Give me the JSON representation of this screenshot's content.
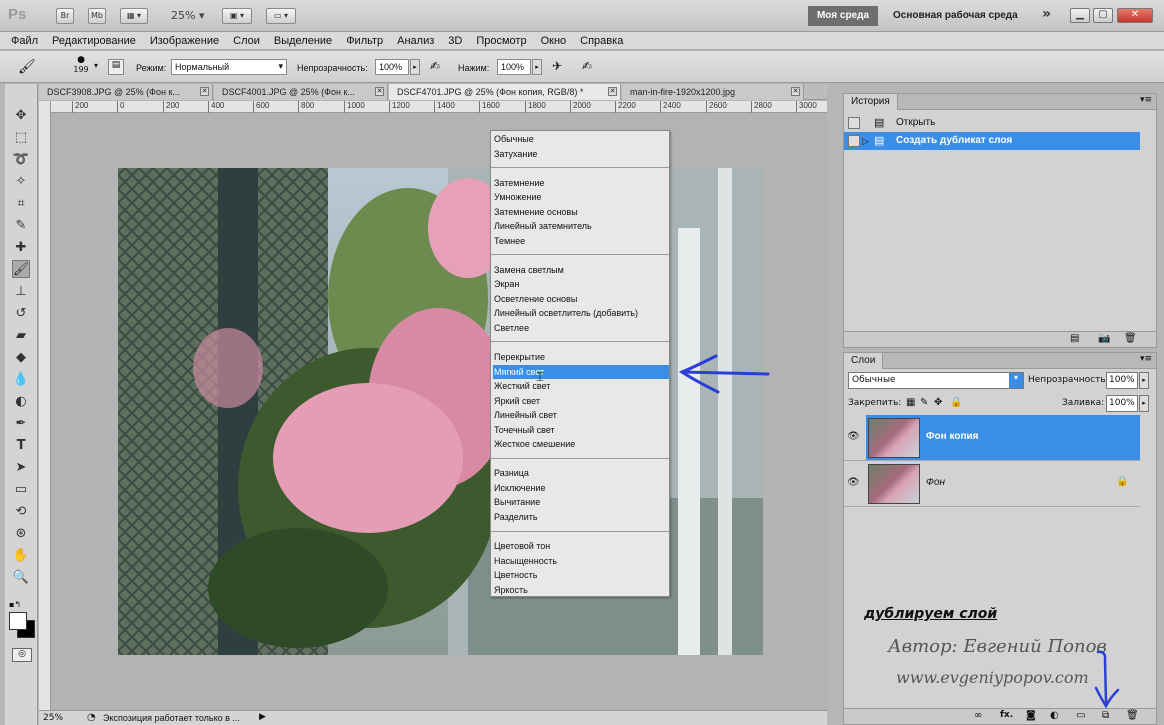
{
  "app": {
    "logo": "Ps",
    "bridge_btn": "Br",
    "mini_bridge_btn": "Mb",
    "zoom_level": "25%",
    "workspace_active": "Моя среда",
    "workspace_other": "Основная рабочая среда",
    "workspace_more": "»"
  },
  "menu": [
    "Файл",
    "Редактирование",
    "Изображение",
    "Слои",
    "Выделение",
    "Фильтр",
    "Анализ",
    "3D",
    "Просмотр",
    "Окно",
    "Справка"
  ],
  "options": {
    "brush_size": "199",
    "mode_label": "Режим:",
    "mode_value": "Нормальный",
    "opacity_label": "Непрозрачность:",
    "opacity_value": "100%",
    "flow_label": "Нажим:",
    "flow_value": "100%"
  },
  "doc_tabs": [
    "DSCF3908.JPG @ 25% (Фон к...",
    "DSCF4001.JPG @ 25% (Фон к...",
    "DSCF4701.JPG @ 25% (Фон копия, RGB/8) *",
    "man-in-fire-1920x1200.jpg"
  ],
  "ruler_ticks": [
    "200",
    "0",
    "200",
    "400",
    "600",
    "800",
    "1000",
    "1200",
    "1400",
    "1600",
    "1800",
    "2000",
    "2200",
    "2400",
    "2600",
    "2800",
    "3000"
  ],
  "blend_groups": [
    [
      "Обычные",
      "Затухание"
    ],
    [
      "Затемнение",
      "Умножение",
      "Затемнение основы",
      "Линейный затемнитель",
      "Темнее"
    ],
    [
      "Замена светлым",
      "Экран",
      "Осветление основы",
      "Линейный осветлитель (добавить)",
      "Светлее"
    ],
    [
      "Перекрытие",
      "Мягкий свет",
      "Жесткий свет",
      "Яркий свет",
      "Линейный свет",
      "Точечный свет",
      "Жесткое смешение"
    ],
    [
      "Разница",
      "Исключение",
      "Вычитание",
      "Разделить"
    ],
    [
      "Цветовой тон",
      "Насыщенность",
      "Цветность",
      "Яркость"
    ]
  ],
  "blend_selected": "Мягкий свет",
  "status": {
    "zoom": "25%",
    "info": "Экспозиция работает только в ..."
  },
  "history": {
    "tab": "История",
    "items": [
      "Открыть",
      "Создать дубликат слоя"
    ],
    "selected_index": 1
  },
  "layers": {
    "tab": "Слои",
    "blend_mode": "Обычные",
    "opacity_label": "Непрозрачность:",
    "opacity_value": "100%",
    "lock_label": "Закрепить:",
    "fill_label": "Заливка:",
    "fill_value": "100%",
    "items": [
      {
        "name": "Фон копия",
        "selected": true
      },
      {
        "name": "Фон",
        "selected": false,
        "locked": true
      }
    ]
  },
  "annotations": {
    "caption": "дублируем слой",
    "author": "Автор: Евгений Попов",
    "site": "www.evgeniypopov.com"
  },
  "colors": {
    "accent": "#3a8ee6",
    "arrow": "#2b3fd6"
  }
}
